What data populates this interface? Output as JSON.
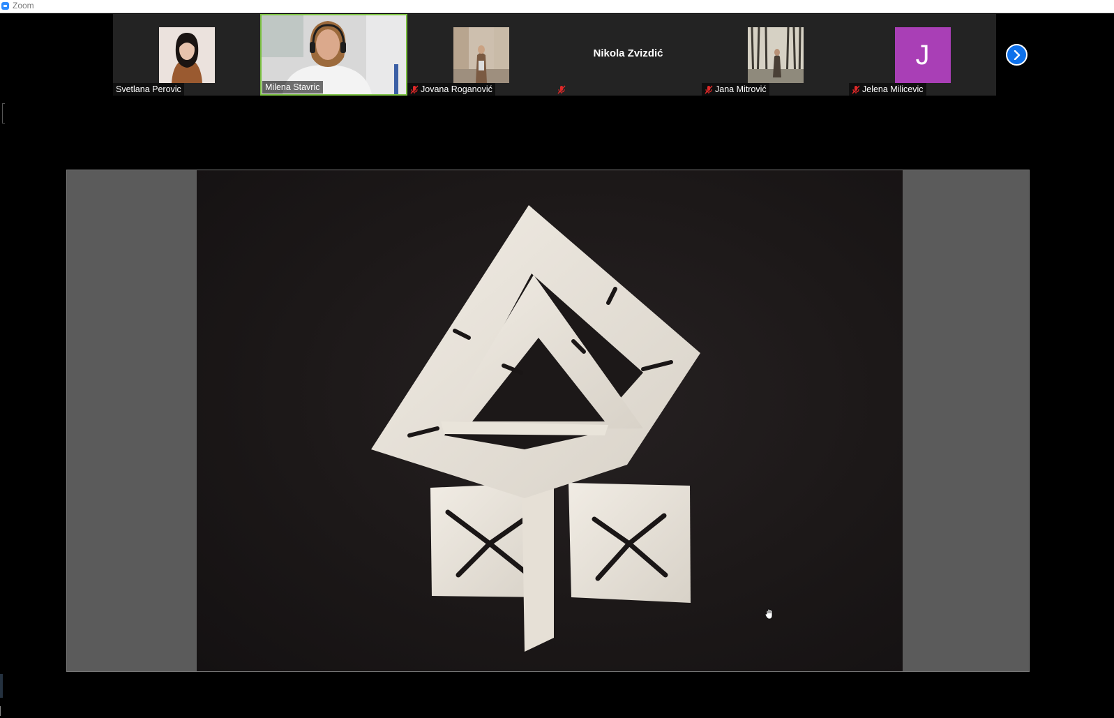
{
  "window": {
    "title": "Zoom"
  },
  "participants": [
    {
      "name": "Svetlana Perovic",
      "muted": false,
      "type": "photo",
      "photo_colors": [
        "#ead8cf",
        "#1b1513",
        "#a55a2c"
      ]
    },
    {
      "name": "Milena Stavric",
      "muted": false,
      "type": "video",
      "active_speaker": true
    },
    {
      "name": "Jovana Roganović",
      "muted": true,
      "type": "photo",
      "photo_colors": [
        "#c6b09a",
        "#7d6048",
        "#dcd2c6"
      ]
    },
    {
      "name": "Nikola Zvizdić",
      "muted": true,
      "type": "name"
    },
    {
      "name": "Jana Mitrović",
      "muted": true,
      "type": "photo",
      "photo_colors": [
        "#d9d4c7",
        "#3e3a33",
        "#8f8a7c"
      ]
    },
    {
      "name": "Jelena Milicevic",
      "muted": true,
      "type": "avatar",
      "avatar_letter": "J",
      "avatar_color": "#a93fb6"
    }
  ],
  "controls": {
    "next_page_icon": "chevron-right-icon"
  },
  "screen_share": {
    "content": "photo of white interlocking sculpture",
    "background_color": "#5b5b5b"
  },
  "colors": {
    "active_speaker_border": "#7cc242",
    "accent": "#0e71eb",
    "mute": "#e02828"
  }
}
